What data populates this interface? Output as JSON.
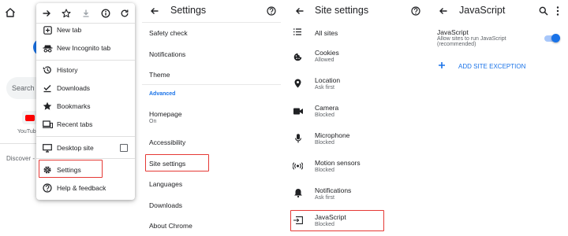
{
  "browser": {
    "search_text": "Search o",
    "shortcut_label": "YouTub",
    "discover_text": "Discover - o"
  },
  "menu": {
    "toolbar_icons": [
      "forward-icon",
      "star-icon",
      "download-icon",
      "info-icon",
      "refresh-icon"
    ],
    "items": [
      {
        "label": "New tab",
        "icon": "plus-box-icon"
      },
      {
        "label": "New Incognito tab",
        "icon": "incognito-icon"
      },
      {
        "label": "History",
        "icon": "history-icon"
      },
      {
        "label": "Downloads",
        "icon": "download-check-icon"
      },
      {
        "label": "Bookmarks",
        "icon": "star-icon"
      },
      {
        "label": "Recent tabs",
        "icon": "devices-icon"
      },
      {
        "label": "Desktop site",
        "icon": "monitor-icon",
        "checkbox": false
      },
      {
        "label": "Settings",
        "icon": "gear-icon",
        "highlighted": true
      },
      {
        "label": "Help & feedback",
        "icon": "help-icon"
      }
    ]
  },
  "settings": {
    "title": "Settings",
    "items": [
      {
        "label": "Safety check"
      },
      {
        "label": "Notifications"
      },
      {
        "label": "Theme"
      },
      {
        "section": "Advanced"
      },
      {
        "label": "Homepage",
        "sub": "On"
      },
      {
        "label": "Accessibility"
      },
      {
        "label": "Site settings",
        "highlighted": true
      },
      {
        "label": "Languages"
      },
      {
        "label": "Downloads"
      },
      {
        "label": "About Chrome"
      }
    ]
  },
  "site_settings": {
    "title": "Site settings",
    "items": [
      {
        "label": "All sites",
        "icon": "list-icon"
      },
      {
        "label": "Cookies",
        "sub": "Allowed",
        "icon": "cookie-icon"
      },
      {
        "label": "Location",
        "sub": "Ask first",
        "icon": "location-pin-icon"
      },
      {
        "label": "Camera",
        "sub": "Blocked",
        "icon": "camera-icon"
      },
      {
        "label": "Microphone",
        "sub": "Blocked",
        "icon": "microphone-icon"
      },
      {
        "label": "Motion sensors",
        "sub": "Blocked",
        "icon": "motion-sensor-icon"
      },
      {
        "label": "Notifications",
        "sub": "Ask first",
        "icon": "bell-icon"
      },
      {
        "label": "JavaScript",
        "sub": "Blocked",
        "icon": "javascript-icon",
        "highlighted": true
      }
    ]
  },
  "javascript": {
    "title": "JavaScript",
    "toggle_title": "JavaScript",
    "toggle_desc_line1": "Allow sites to run JavaScript",
    "toggle_desc_line2": "(recommended)",
    "toggle_on": true,
    "add_exception": "ADD SITE EXCEPTION"
  },
  "colors": {
    "accent": "#1a73e8",
    "highlight_border": "#e53935",
    "icon": "#202124",
    "secondary_text": "#5f6368"
  }
}
